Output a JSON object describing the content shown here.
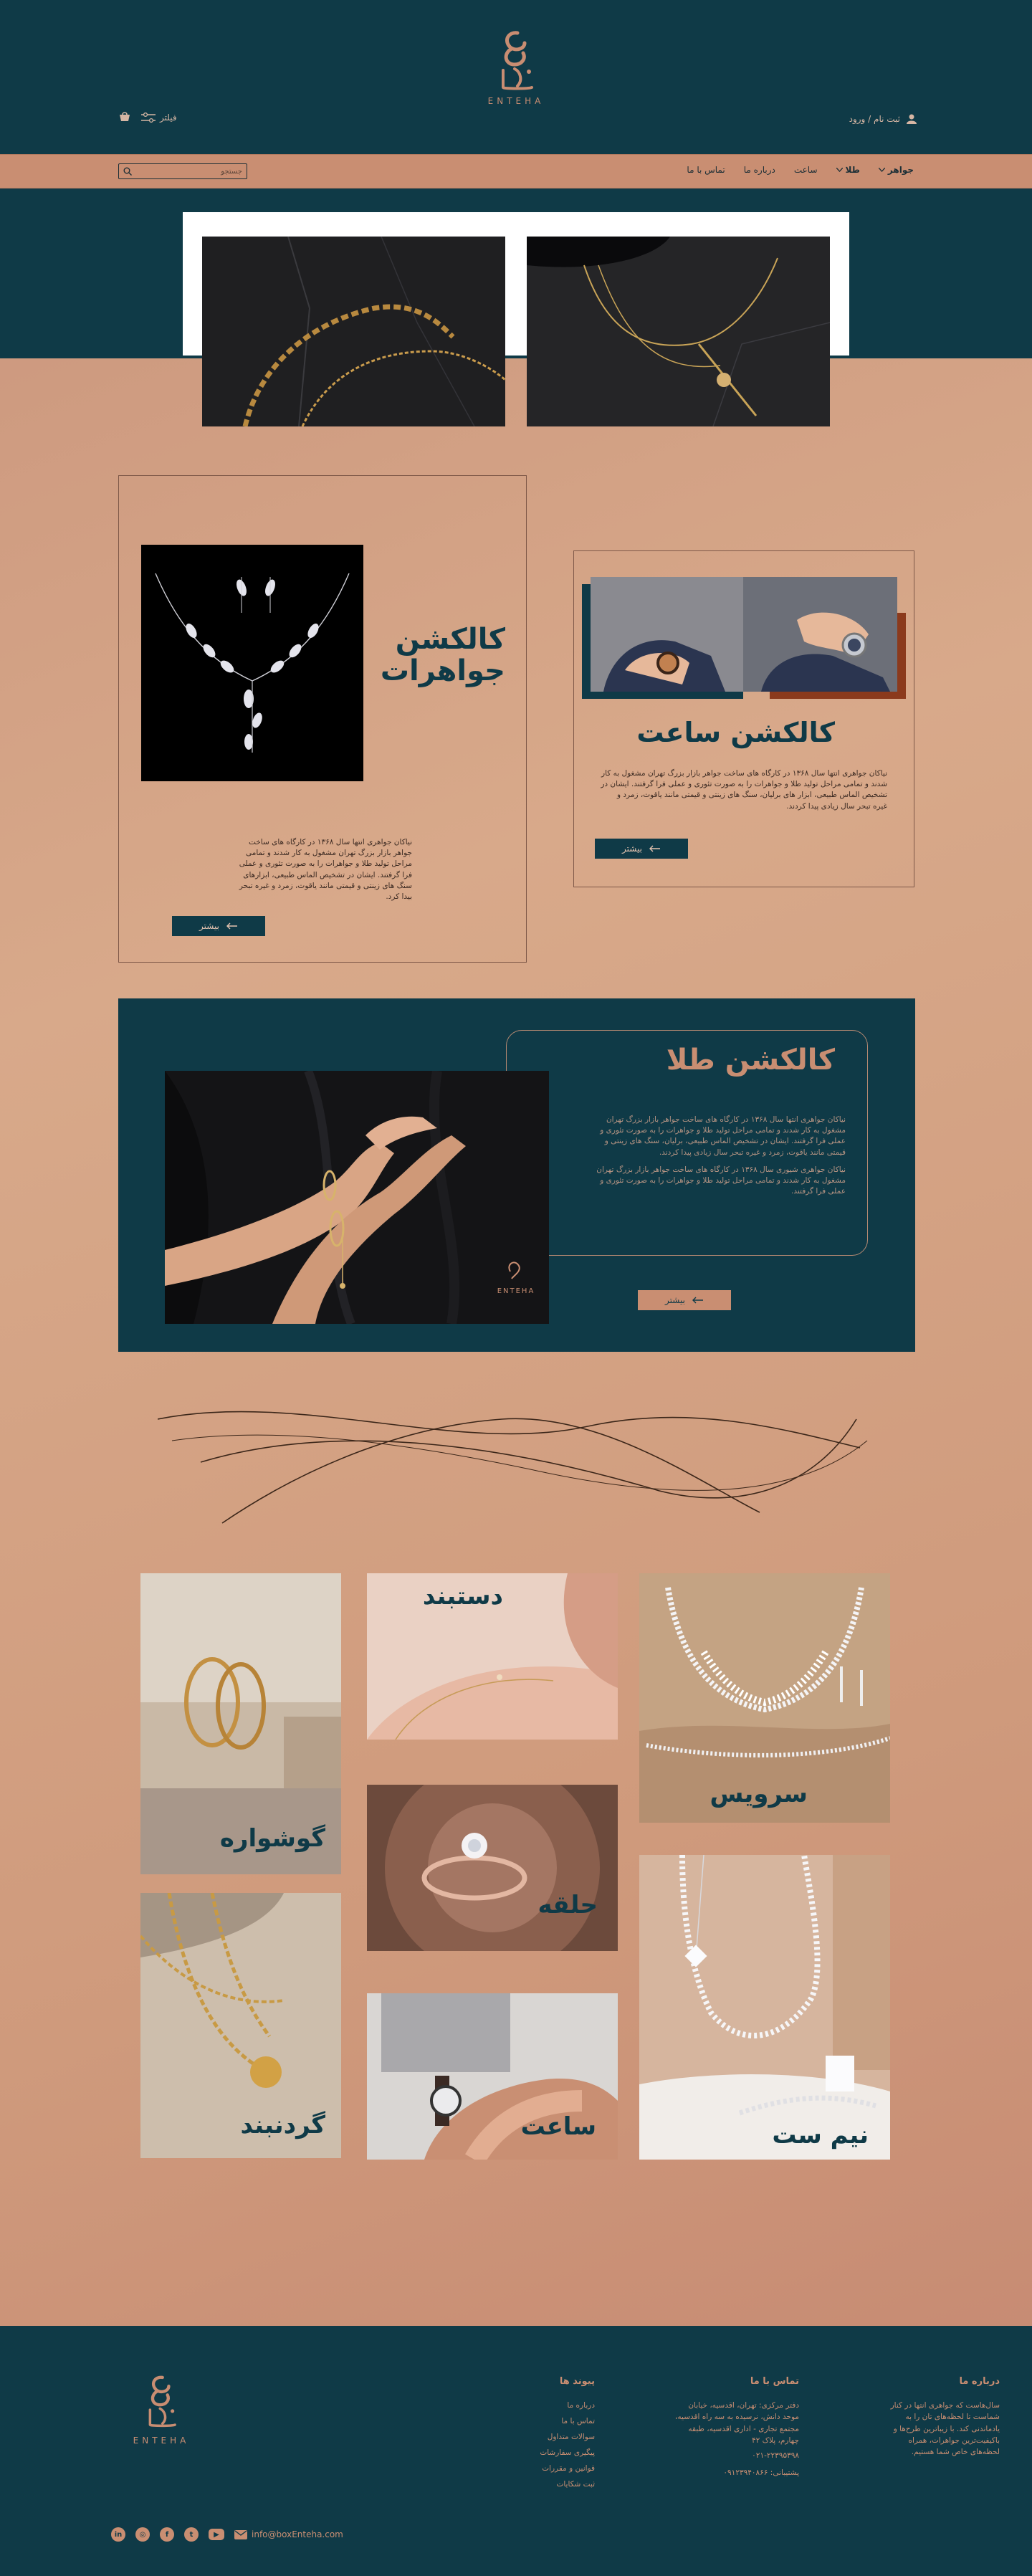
{
  "brand": {
    "logo_text": "ENTEHA"
  },
  "header": {
    "account_label": "ثبت نام / ورود",
    "filter_label": "فیلتر"
  },
  "nav": {
    "items": [
      "جواهر",
      "طلا",
      "ساعت",
      "درباره ما",
      "تماس با ما"
    ],
    "search_placeholder": "جستجو"
  },
  "jewelry_collection": {
    "title_line1": "کالکشن",
    "title_line2": "جواهرات",
    "description": "نیاکان جواهری انتها سال ۱۳۶۸ در کارگاه های ساخت جواهر بازار بزرگ تهران مشغول به کار شدند و تمامی مراحل تولید طلا و جواهرات را به صورت تئوری و عملی فرا گرفتند. ایشان در تشخیص الماس طبیعی، ابزارهای سنگ های زینتی و قیمتی مانند یاقوت، زمرد و غیره تبحر بیدا کرد.",
    "button": "بیشتر"
  },
  "watch_collection": {
    "title": "کالکشن ساعت",
    "description": "نیاکان جواهری انتها سال ۱۳۶۸ در کارگاه های ساخت جواهر بازار بزرگ تهران مشغول به کار شدند و تمامی مراحل تولید طلا و جواهرات را به صورت تئوری و عملی فرا گرفتند. ایشان در تشخیص الماس طبیعی، ابزار های برلیان، سنگ های زینتی و قیمتی مانند یاقوت، زمرد و غیره تبحر سال زیادی پیدا کردند.",
    "button": "بیشتر"
  },
  "gold_collection": {
    "title": "کالکشن طلا",
    "description1": "نیاکان جواهری انتها سال ۱۳۶۸ در کارگاه های ساخت جواهر بازار بزرگ تهران مشغول به کار شدند و تمامی مراحل تولید طلا و جواهرات را به صورت تئوری و عملی فرا گرفتند. ایشان در تشخیص الماس طبیعی، برلیان، سنگ های زینتی و قیمتی مانند یاقوت، زمرد و غیره تبحر سال زیادی پیدا کردند.",
    "description2": "نیاکان جواهری شیوری سال ۱۳۶۸ در کارگاه های ساخت جواهر بازار بزرگ تهران مشغول به کار شدند و تمامی مراحل تولید طلا و جواهرات را به صورت تئوری و عملی فرا گرفتند.",
    "button": "بیشتر"
  },
  "categories": {
    "earrings": "گوشواره",
    "bracelet": "دستبند",
    "set": "سرویس",
    "ring": "حلقه",
    "necklace": "گردنبند",
    "watch": "ساعت",
    "half_set": "نیم ست"
  },
  "footer": {
    "about_title": "درباره ما",
    "about_text": "سال‌هاست که جواهری انتها در کنار شماست تا لحظه‌های تان را به یادماندنی کند. با زیباترین طرح‌ها و باکیفیت‌ترین جواهرات، همراه لحظه‌های خاص شما هستیم.",
    "contact_title": "تماس با ما",
    "contact_address": "دفتر مرکزی: تهران، اقدسیه، خیابان موحد دانش، نرسیده به سه راه اقدسیه، مجتمع تجاری - اداری اقدسیه، طبقه چهارم، پلاک ۴۲",
    "contact_phone": "۰۲۱-۲۲۳۹۵۳۹۸",
    "contact_support": "پشتیبانی: ۰۹۱۲۳۹۴۰۸۶۶",
    "links_title": "پیوند ها",
    "links": [
      "درباره ما",
      "تماس با ما",
      "سوالات متداول",
      "پیگیری سفارشات",
      "قوانین و مقررات",
      "ثبت شکایات"
    ],
    "email": "info@boxEnteha.com"
  },
  "colors": {
    "teal": "#0f3a47",
    "copper": "#c98e72",
    "peach": "#d8a98a"
  }
}
